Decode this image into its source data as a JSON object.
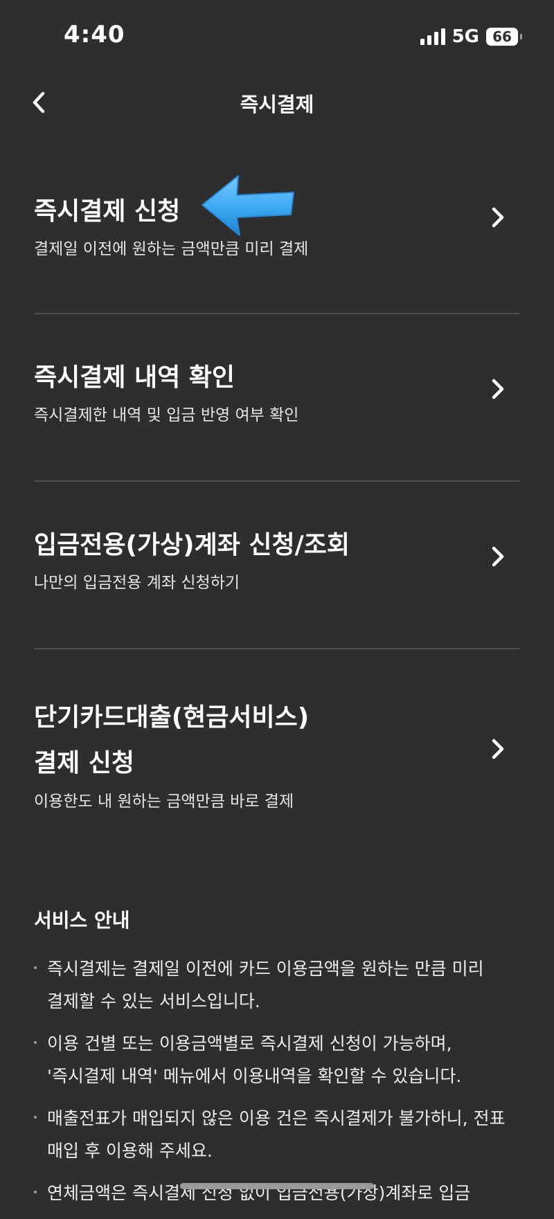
{
  "status_bar": {
    "time": "4:40",
    "network": "5G",
    "battery": "66"
  },
  "nav": {
    "title": "즉시결제",
    "back_icon": "chevron-left-icon"
  },
  "menu": [
    {
      "title": "즉시결제 신청",
      "description": "결제일 이전에 원하는 금액만큼 미리 결제"
    },
    {
      "title": "즉시결제 내역 확인",
      "description": "즉시결제한 내역 및 입금 반영 여부 확인"
    },
    {
      "title": "입금전용(가상)계좌 신청/조회",
      "description": "나만의 입금전용 계좌 신청하기"
    },
    {
      "title": "단기카드대출(현금서비스) 결제 신청",
      "description": "이용한도 내 원하는 금액만큼 바로 결제"
    }
  ],
  "notice": {
    "title": "서비스 안내",
    "items": [
      "즉시결제는 결제일 이전에 카드 이용금액을 원하는 만큼 미리 결제할 수 있는 서비스입니다.",
      "이용 건별 또는 이용금액별로 즉시결제 신청이 가능하며, '즉시결제 내역' 메뉴에서 이용내역을 확인할 수 있습니다.",
      "매출전표가 매입되지 않은 이용 건은 즉시결제가 불가하니, 전표 매입 후 이용해 주세요.",
      "연체금액은 즉시결제 신청 없이 입금전용(가상)계좌로 입금"
    ]
  },
  "colors": {
    "background": "#2e2e2e",
    "divider": "#4d4d4d",
    "pointer_arrow": "#3aa8f0"
  }
}
